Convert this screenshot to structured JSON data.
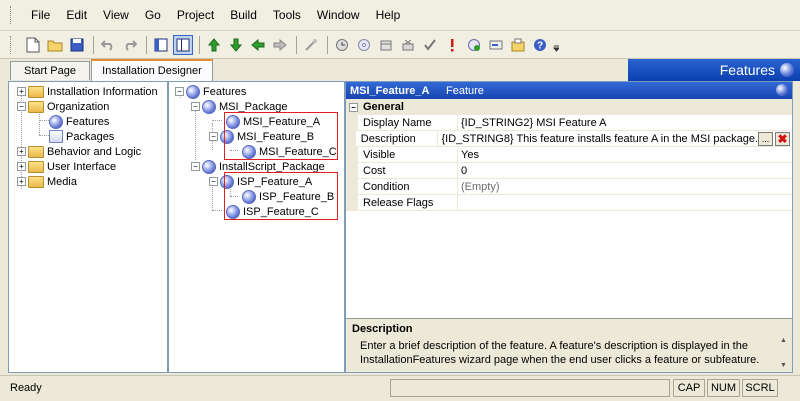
{
  "menu": [
    "File",
    "Edit",
    "View",
    "Go",
    "Project",
    "Build",
    "Tools",
    "Window",
    "Help"
  ],
  "toolbar_icons": [
    "new-icon",
    "open-icon",
    "save-icon",
    "undo-icon",
    "redo-icon",
    "view-left-icon",
    "view-right-icon",
    "arrow-up-icon",
    "arrow-down-icon",
    "arrow-left-icon",
    "arrow-right-icon",
    "wand-icon",
    "build-icon",
    "cd-icon",
    "release-icon",
    "remove-icon",
    "check-icon",
    "exclamation-icon",
    "install-icon",
    "insert-icon",
    "package-icon",
    "help-icon"
  ],
  "tabs": {
    "start": "Start Page",
    "designer": "Installation Designer"
  },
  "view_title": "Features",
  "left_tree": {
    "installation_information": "Installation Information",
    "organization": "Organization",
    "features": "Features",
    "packages": "Packages",
    "behavior_logic": "Behavior and Logic",
    "user_interface": "User Interface",
    "media": "Media"
  },
  "feature_tree": {
    "root": "Features",
    "msi_package": "MSI_Package",
    "msi_a": "MSI_Feature_A",
    "msi_b": "MSI_Feature_B",
    "msi_c": "MSI_Feature_C",
    "isp_package": "InstallScript_Package",
    "isp_a": "ISP_Feature_A",
    "isp_b": "ISP_Feature_B",
    "isp_c": "ISP_Feature_C"
  },
  "properties": {
    "header_name": "MSI_Feature_A",
    "header_kind": "Feature",
    "group": "General",
    "rows": [
      {
        "name": "Display Name",
        "value": "{ID_STRING2} MSI Feature A"
      },
      {
        "name": "Description",
        "value": "{ID_STRING8} This feature installs feature A in the MSI package."
      },
      {
        "name": "Visible",
        "value": "Yes"
      },
      {
        "name": "Cost",
        "value": "0"
      },
      {
        "name": "Condition",
        "value": "(Empty)"
      },
      {
        "name": "Release Flags",
        "value": ""
      }
    ],
    "ellipsis": "...",
    "clear": "✖"
  },
  "description": {
    "title": "Description",
    "text": "Enter a brief description of the feature. A feature's description is displayed in the InstallationFeatures wizard page when the end user clicks a feature or subfeature."
  },
  "status": {
    "text": "Ready",
    "cap": "CAP",
    "num": "NUM",
    "scrl": "SCRL"
  }
}
